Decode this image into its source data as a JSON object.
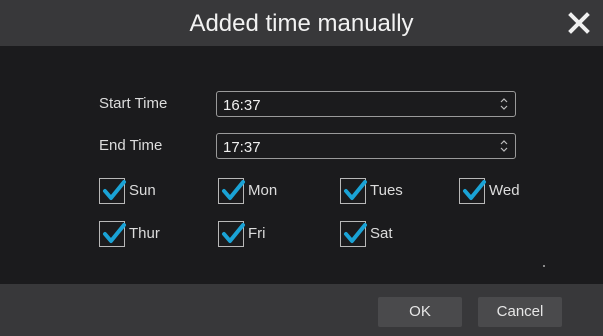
{
  "dialog": {
    "title": "Added time manually",
    "close_icon": "close-icon"
  },
  "form": {
    "start_time": {
      "label": "Start Time",
      "value": "16:37"
    },
    "end_time": {
      "label": "End Time",
      "value": "17:37"
    }
  },
  "days": [
    {
      "label": "Sun",
      "checked": true
    },
    {
      "label": "Mon",
      "checked": true
    },
    {
      "label": "Tues",
      "checked": true
    },
    {
      "label": "Wed",
      "checked": true
    },
    {
      "label": "Thur",
      "checked": true
    },
    {
      "label": "Fri",
      "checked": true
    },
    {
      "label": "Sat",
      "checked": true
    }
  ],
  "footer": {
    "ok_label": "OK",
    "cancel_label": "Cancel"
  },
  "colors": {
    "check_accent": "#1aa3d6",
    "titlebar": "#38383a",
    "background": "#1b1b1d"
  }
}
